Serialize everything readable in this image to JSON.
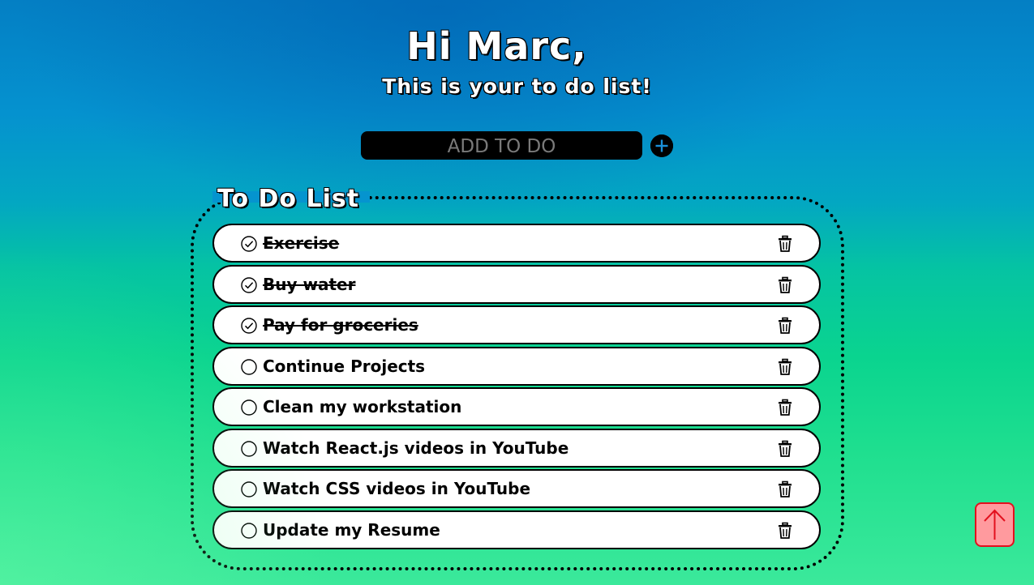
{
  "header": {
    "greeting": "Hi Marc,",
    "subtitle": "This is your to do list!"
  },
  "add_form": {
    "placeholder": "ADD TO DO",
    "value": "",
    "add_icon": "plus-circle-icon"
  },
  "list": {
    "title": "To Do List",
    "items": [
      {
        "label": "Exercise",
        "done": true
      },
      {
        "label": "Buy water",
        "done": true
      },
      {
        "label": "Pay for groceries",
        "done": true
      },
      {
        "label": "Continue Projects",
        "done": false
      },
      {
        "label": "Clean my workstation",
        "done": false
      },
      {
        "label": "Watch React.js videos in YouTube",
        "done": false
      },
      {
        "label": "Watch CSS videos in YouTube",
        "done": false
      },
      {
        "label": "Update my Resume",
        "done": false
      }
    ],
    "done_icon": "check-circle-icon",
    "pending_icon": "empty-circle-icon",
    "delete_icon": "trash-icon"
  },
  "scroll_top": {
    "icon": "arrow-up-icon"
  },
  "colors": {
    "accent_plus": "#1a8fd8",
    "scroll_top_fill": "#ff9a9e",
    "scroll_top_border": "#e3101e",
    "item_background": "#ffffff"
  }
}
